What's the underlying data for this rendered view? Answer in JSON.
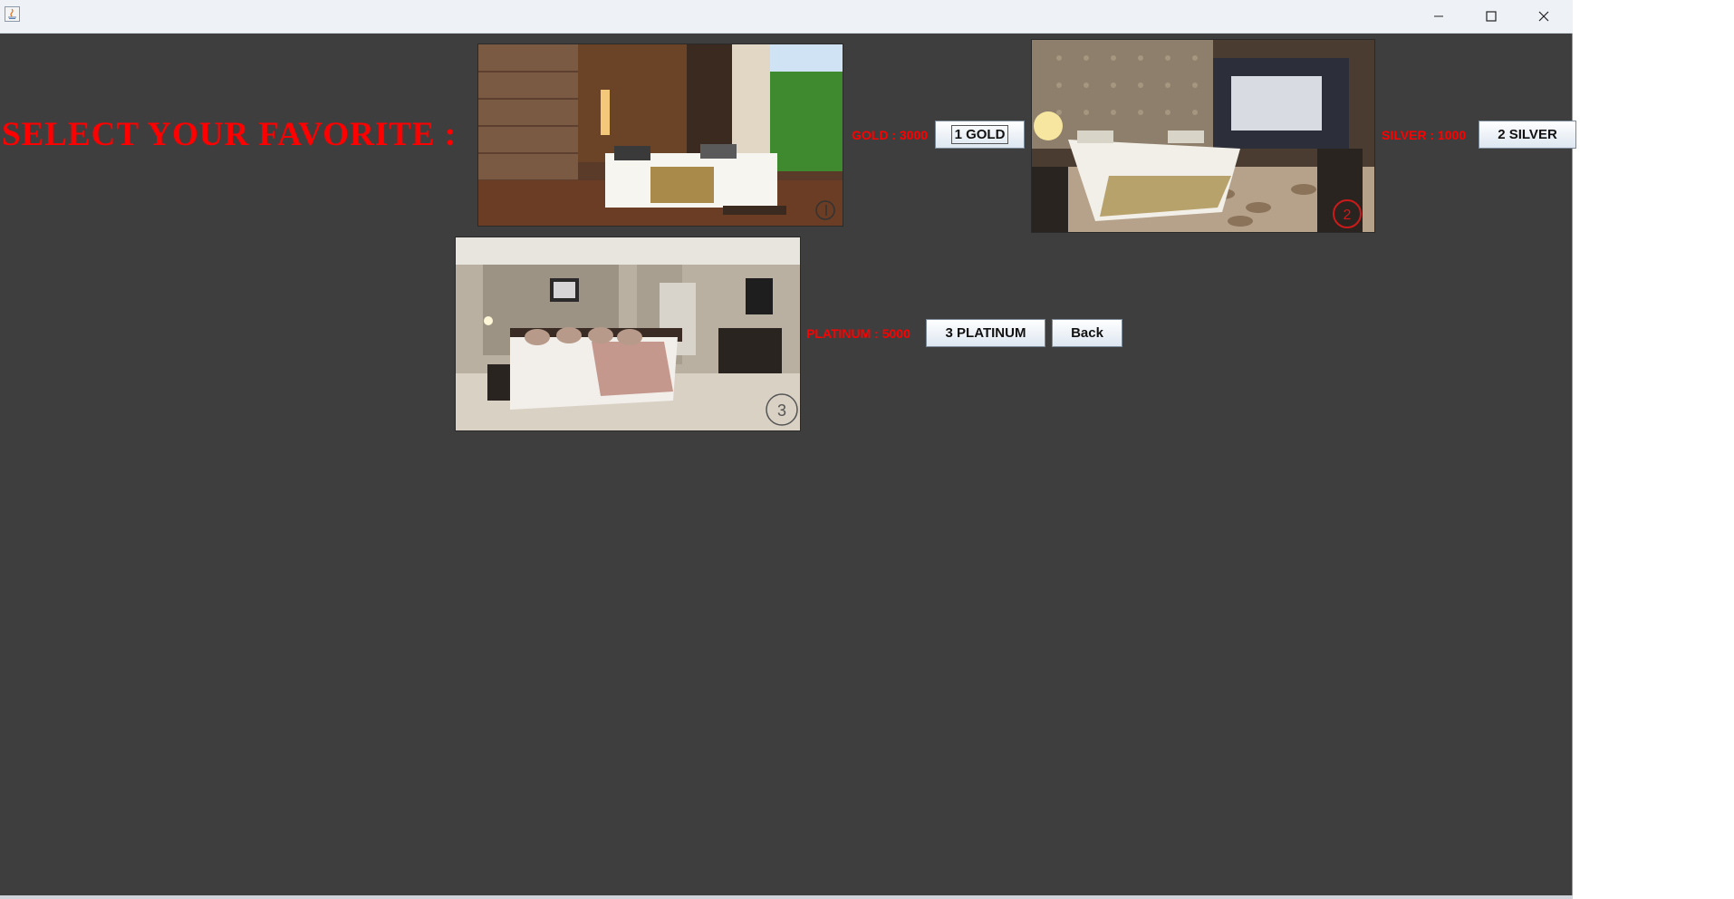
{
  "window": {
    "controls": {
      "minimize_icon": "minimize-icon",
      "maximize_icon": "maximize-icon",
      "close_icon": "close-icon"
    }
  },
  "heading": "SELECT YOUR FAVORITE :",
  "rooms": [
    {
      "price_label": "GOLD : 3000",
      "button_label": "1 GOLD",
      "badge": "1"
    },
    {
      "price_label": "SILVER : 1000",
      "button_label": "2 SILVER",
      "badge": "2"
    },
    {
      "price_label": "PLATINUM : 5000",
      "button_label": "3 PLATINUM",
      "badge": "3"
    }
  ],
  "back_label": "Back",
  "colors": {
    "background": "#3e3e3e",
    "accent_text": "#ff0000",
    "titlebar": "#eef2f7"
  }
}
